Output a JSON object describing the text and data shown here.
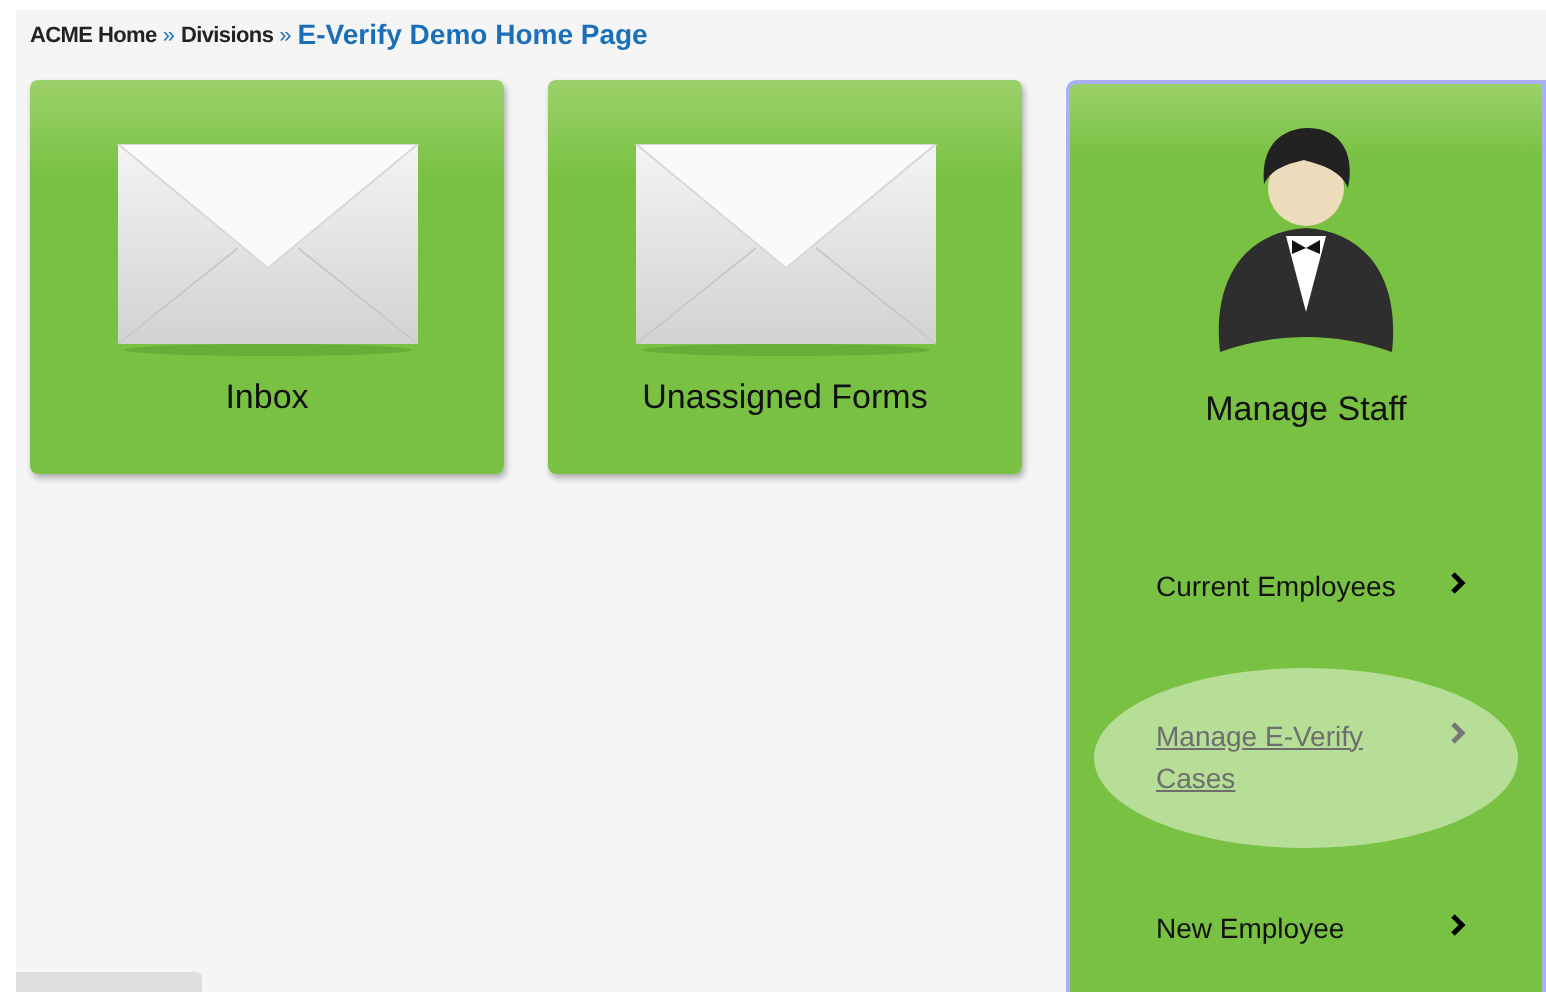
{
  "breadcrumb": {
    "links": [
      "ACME Home",
      "Divisions"
    ],
    "separator": "»",
    "current": "E-Verify Demo Home Page"
  },
  "tiles": [
    {
      "label": "Inbox"
    },
    {
      "label": "Unassigned Forms"
    }
  ],
  "staff_panel": {
    "title": "Manage Staff",
    "items": [
      {
        "label": "Current Employees",
        "hovered": false
      },
      {
        "label": "Manage E-Verify Cases",
        "hovered": true
      },
      {
        "label": "New Employee",
        "hovered": false
      }
    ]
  }
}
